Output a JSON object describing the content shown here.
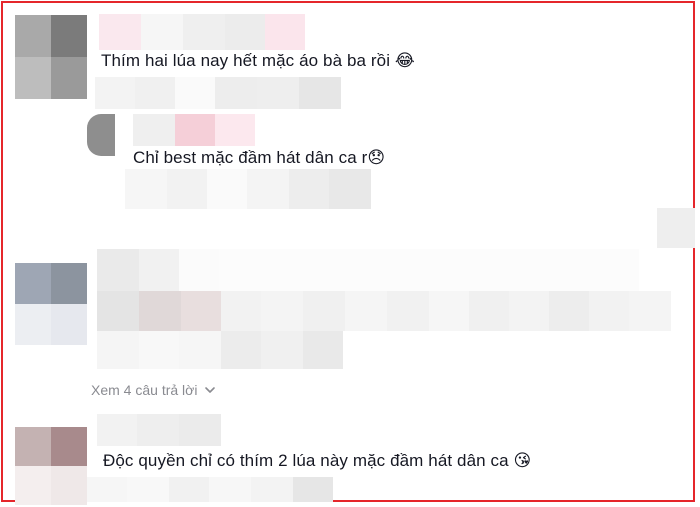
{
  "comments": [
    {
      "text": "Thím hai lúa nay hết mặc áo bà ba rồi",
      "emoji": "😂"
    },
    {
      "text": "Chỉ best mặc đầm hát dân ca r",
      "emoji": "😞"
    },
    {
      "text": "Độc quyền chỉ có thím 2 lúa này mặc đầm hát dân ca",
      "emoji": "😘"
    }
  ],
  "view_replies": {
    "label": "Xem 4 câu trả lời"
  },
  "colors": {
    "border": "#e5262b",
    "muted_text": "#8a8b91"
  }
}
